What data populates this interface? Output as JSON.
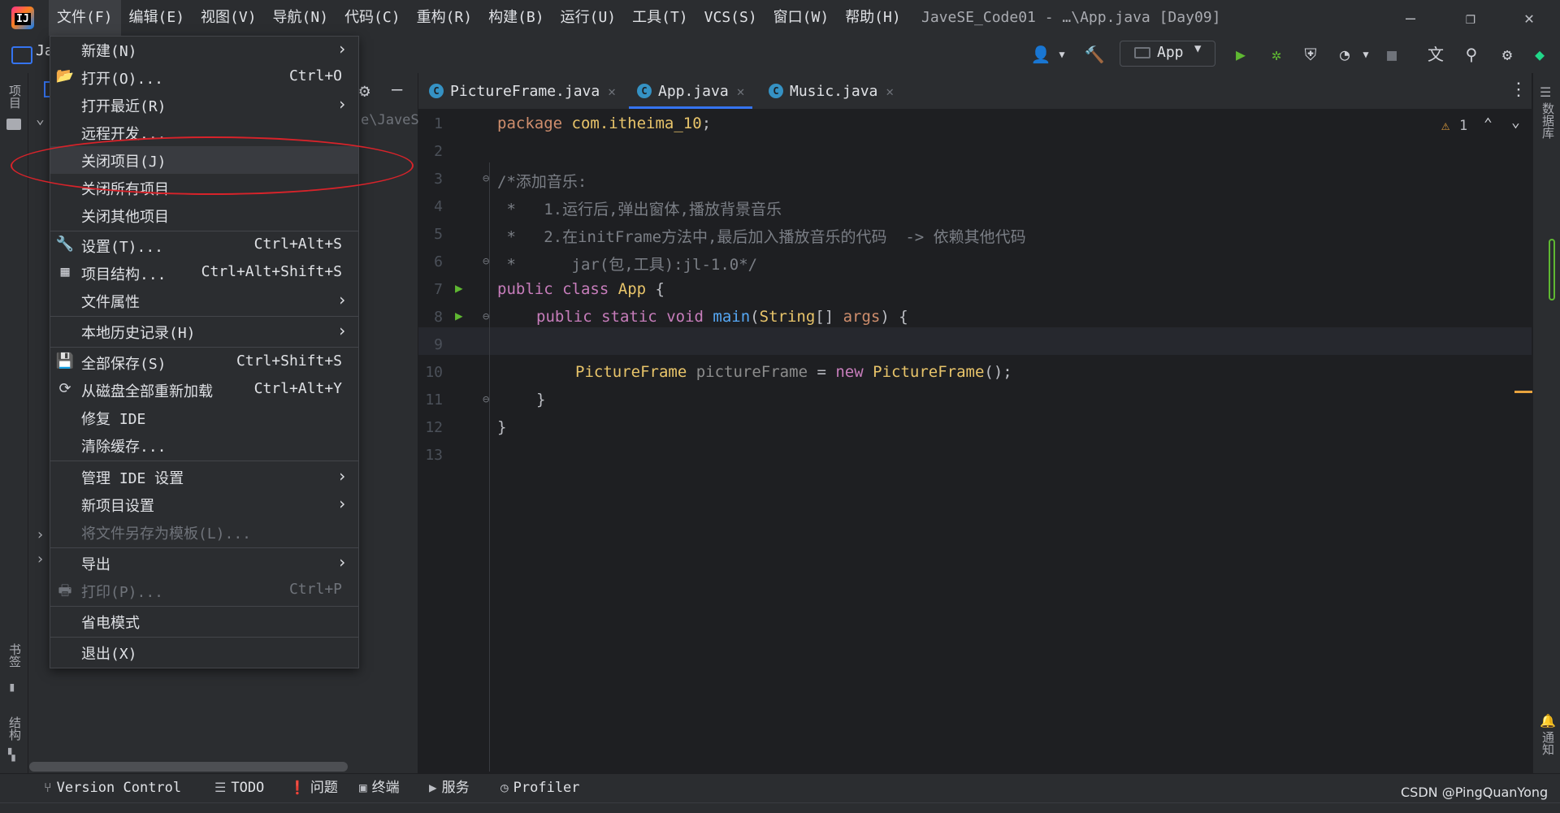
{
  "titlebar": {
    "menus": [
      "文件(F)",
      "编辑(E)",
      "视图(V)",
      "导航(N)",
      "代码(C)",
      "重构(R)",
      "构建(B)",
      "运行(U)",
      "工具(T)",
      "VCS(S)",
      "窗口(W)",
      "帮助(H)"
    ],
    "window_title": "JaveSE_Code01 - …\\App.java [Day09]",
    "minimize": "—",
    "restore": "❐",
    "close": "✕"
  },
  "toolbar": {
    "project_short": "Ja",
    "run_config": "App"
  },
  "left_strip": {
    "project_label": "项目",
    "bookmarks_label": "书签",
    "structure_label": "结构"
  },
  "right_strip": {
    "database_label": "数据库",
    "notifications_label": "通知"
  },
  "project_panel": {
    "path_fragment": "e\\JaveS"
  },
  "tabs": [
    {
      "label": "PictureFrame.java",
      "active": false
    },
    {
      "label": "App.java",
      "active": true
    },
    {
      "label": "Music.java",
      "active": false
    }
  ],
  "editor": {
    "warning_count": "1",
    "line_numbers": [
      "1",
      "2",
      "3",
      "4",
      "5",
      "6",
      "7",
      "8",
      "9",
      "10",
      "11",
      "12",
      "13"
    ],
    "lines": {
      "l1_kw": "package",
      "l1_pkg": "com.itheima_10",
      "l1_end": ";",
      "l3": "/*添加音乐:",
      "l4": " *   1.运行后,弹出窗体,播放背景音乐",
      "l5": " *   2.在initFrame方法中,最后加入播放音乐的代码  -> 依赖其他代码",
      "l6": " *      jar(包,工具):jl-1.0*/",
      "l7_kw1": "public",
      "l7_kw2": "class",
      "l7_cls": "App",
      "l7_end": " {",
      "l8_kw1": "public",
      "l8_kw2": "static",
      "l8_kw3": "void",
      "l8_fn": "main",
      "l8_open": "(",
      "l8_type": "String",
      "l8_arr": "[] ",
      "l8_par": "args",
      "l8_end": ") {",
      "l10_cls": "PictureFrame",
      "l10_var": "pictureFrame",
      "l10_eq": " = ",
      "l10_new": "new",
      "l10_cls2": "PictureFrame",
      "l10_end": "();",
      "l11": "}",
      "l12": "}"
    }
  },
  "file_menu": {
    "items": [
      {
        "label": "新建(N)",
        "shortcut": "",
        "submenu": true,
        "icon": ""
      },
      {
        "label": "打开(O)...",
        "shortcut": "Ctrl+O",
        "submenu": false,
        "icon": "folder-open-icon"
      },
      {
        "label": "打开最近(R)",
        "shortcut": "",
        "submenu": true,
        "icon": ""
      },
      {
        "label": "远程开发...",
        "shortcut": "",
        "submenu": false,
        "icon": ""
      },
      {
        "label": "关闭项目(J)",
        "shortcut": "",
        "submenu": false,
        "icon": ""
      },
      {
        "label": "关闭所有项目",
        "shortcut": "",
        "submenu": false,
        "icon": ""
      },
      {
        "label": "关闭其他项目",
        "shortcut": "",
        "submenu": false,
        "icon": ""
      },
      {
        "label": "设置(T)...",
        "shortcut": "Ctrl+Alt+S",
        "submenu": false,
        "icon": "wrench-icon"
      },
      {
        "label": "项目结构...",
        "shortcut": "Ctrl+Alt+Shift+S",
        "submenu": false,
        "icon": "project-structure-icon"
      },
      {
        "label": "文件属性",
        "shortcut": "",
        "submenu": true,
        "icon": ""
      },
      {
        "label": "本地历史记录(H)",
        "shortcut": "",
        "submenu": true,
        "icon": ""
      },
      {
        "label": "全部保存(S)",
        "shortcut": "Ctrl+Shift+S",
        "submenu": false,
        "icon": "save-icon"
      },
      {
        "label": "从磁盘全部重新加载",
        "shortcut": "Ctrl+Alt+Y",
        "submenu": false,
        "icon": "reload-icon"
      },
      {
        "label": "修复 IDE",
        "shortcut": "",
        "submenu": false,
        "icon": ""
      },
      {
        "label": "清除缓存...",
        "shortcut": "",
        "submenu": false,
        "icon": ""
      },
      {
        "label": "管理 IDE 设置",
        "shortcut": "",
        "submenu": true,
        "icon": ""
      },
      {
        "label": "新项目设置",
        "shortcut": "",
        "submenu": true,
        "icon": ""
      },
      {
        "label": "将文件另存为模板(L)...",
        "shortcut": "",
        "submenu": false,
        "icon": "",
        "disabled": true
      },
      {
        "label": "导出",
        "shortcut": "",
        "submenu": true,
        "icon": ""
      },
      {
        "label": "打印(P)...",
        "shortcut": "Ctrl+P",
        "submenu": false,
        "icon": "print-icon",
        "disabled": true
      },
      {
        "label": "省电模式",
        "shortcut": "",
        "submenu": false,
        "icon": ""
      },
      {
        "label": "退出(X)",
        "shortcut": "",
        "submenu": false,
        "icon": ""
      }
    ],
    "highlighted": "关闭项目(J)",
    "annotation_color": "#d8232a"
  },
  "bottom_tools": [
    "Version Control",
    "TODO",
    "问题",
    "终端",
    "服务",
    "Profiler"
  ],
  "watermark": "CSDN @PingQuanYong",
  "colors": {
    "accent": "#3574f0",
    "run_green": "#5fb832",
    "warning": "#e8a33e"
  }
}
